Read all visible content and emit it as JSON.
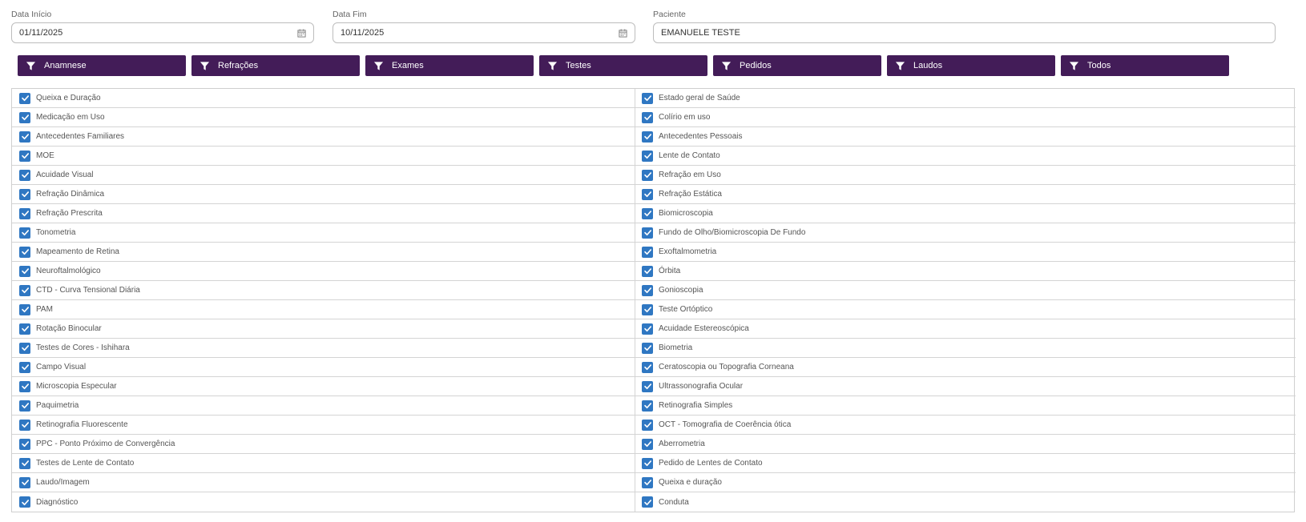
{
  "fields": {
    "start": {
      "label": "Data Início",
      "value": "01/11/2025"
    },
    "end": {
      "label": "Data Fim",
      "value": "10/11/2025"
    },
    "patient": {
      "label": "Paciente",
      "value": "EMANUELE TESTE"
    }
  },
  "filters": [
    "Anamnese",
    "Refrações",
    "Exames",
    "Testes",
    "Pedidos",
    "Laudos",
    "Todos"
  ],
  "colors": {
    "filter_bg": "#431c58",
    "checkbox": "#2f77c2"
  },
  "items_left": [
    "Queixa e Duração",
    "Medicação em Uso",
    "Antecedentes Familiares",
    "MOE",
    "Acuidade Visual",
    "Refração Dinâmica",
    "Refração Prescrita",
    "Tonometria",
    "Mapeamento de Retina",
    "Neuroftalmológico",
    "CTD - Curva Tensional Diária",
    "PAM",
    "Rotação Binocular",
    "Testes de Cores - Ishihara",
    "Campo Visual",
    "Microscopia Especular",
    "Paquimetria",
    "Retinografia Fluorescente",
    "PPC - Ponto Próximo de Convergência",
    "Testes de Lente de Contato",
    "Laudo/Imagem",
    "Diagnóstico"
  ],
  "items_right": [
    "Estado geral de Saúde",
    "Colírio em uso",
    "Antecedentes Pessoais",
    "Lente de Contato",
    "Refração em Uso",
    "Refração Estática",
    "Biomicroscopia",
    "Fundo de Olho/Biomicroscopia De Fundo",
    "Exoftalmometria",
    "Órbita",
    "Gonioscopia",
    "Teste Ortóptico",
    "Acuidade Estereoscópica",
    "Biometria",
    "Ceratoscopia ou Topografia Corneana",
    "Ultrassonografia Ocular",
    "Retinografia Simples",
    "OCT - Tomografia de Coerência ótica",
    "Aberrometria",
    "Pedido de Lentes de Contato",
    "Queixa e duração",
    "Conduta"
  ]
}
